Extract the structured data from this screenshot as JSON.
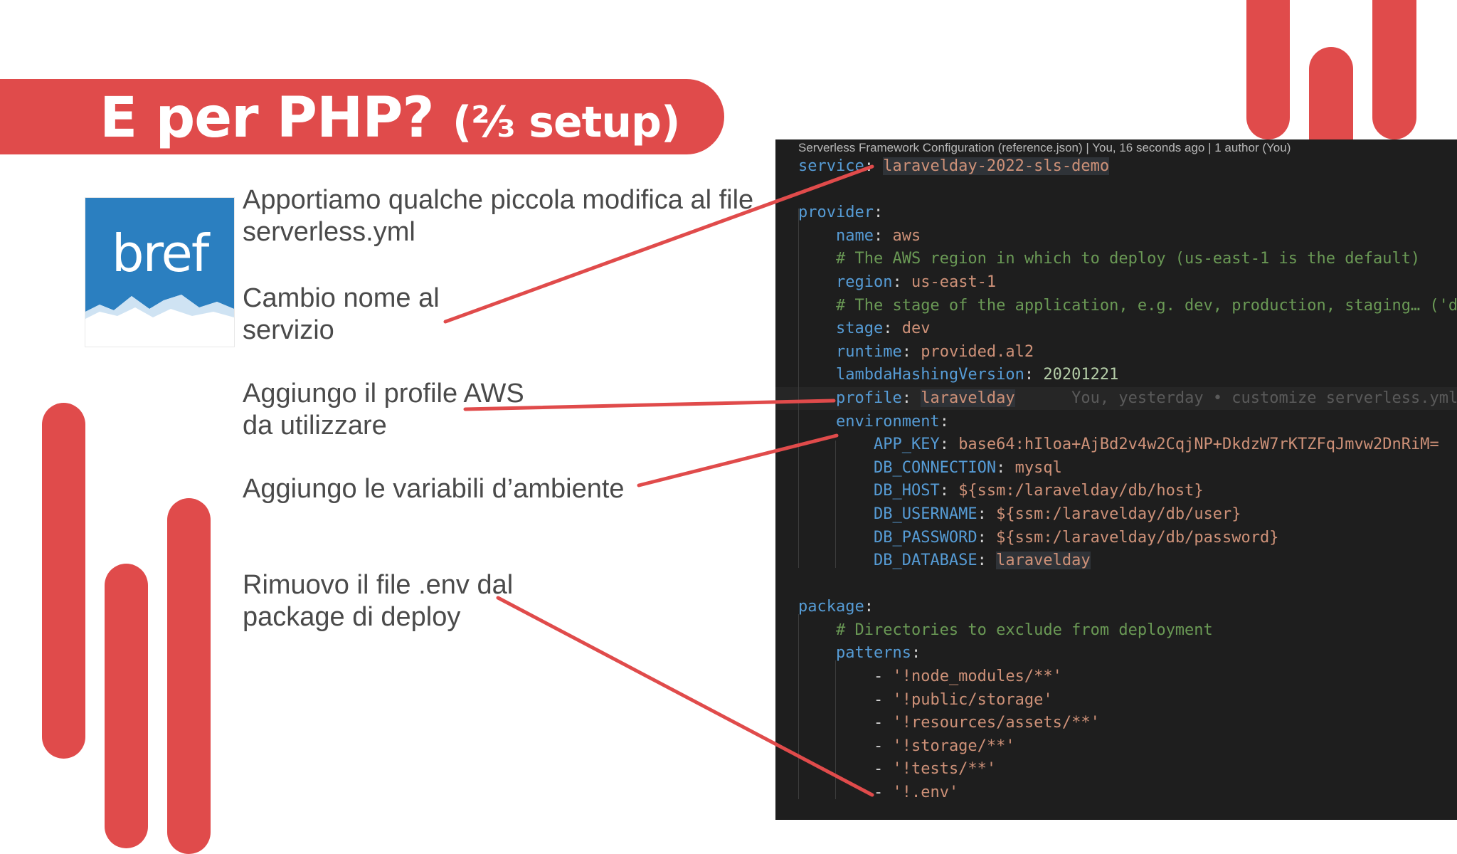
{
  "slide": {
    "title_main": "E per PHP? ",
    "title_paren": "(⅔ setup)",
    "logo_text": "bref",
    "captions": [
      "Apportiamo qualche piccola modifica al file serverless.yml",
      "Cambio nome al servizio",
      "Aggiungo il profile AWS da utilizzare",
      "Aggiungo le variabili d’ambiente",
      "Rimuovo il file .env dal package di deploy"
    ]
  },
  "editor": {
    "hint": "Serverless Framework Configuration (reference.json) | You, 16 seconds ago | 1 author (You)",
    "service": "laravelday-2022-sls-demo",
    "provider_name": "aws",
    "comment_region": "# The AWS region in which to deploy (us-east-1 is the default)",
    "region": "us-east-1",
    "comment_stage": "# The stage of the application, e.g. dev, production, staging… ('de",
    "stage": "dev",
    "runtime": "provided.al2",
    "lambda_hashing_version": "20201221",
    "profile": "laravelday",
    "profile_blame": "You, yesterday • customize serverless.yml",
    "env": {
      "APP_KEY": "base64:hIloa+AjBd2v4w2CqjNP+DkdzW7rKTZFqJmvw2DnRiM=",
      "DB_CONNECTION": "mysql",
      "DB_HOST": "${ssm:/laravelday/db/host}",
      "DB_USERNAME": "${ssm:/laravelday/db/user}",
      "DB_PASSWORD": "${ssm:/laravelday/db/password}",
      "DB_DATABASE": "laravelday"
    },
    "comment_package": "# Directories to exclude from deployment",
    "patterns": [
      "'!node_modules/**'",
      "'!public/storage'",
      "'!resources/assets/**'",
      "'!storage/**'",
      "'!tests/**'",
      "'!.env'"
    ]
  },
  "colors": {
    "accent": "#e04b4b",
    "logo_blue": "#2b7fc0",
    "editor_bg": "#1e1e1e"
  }
}
